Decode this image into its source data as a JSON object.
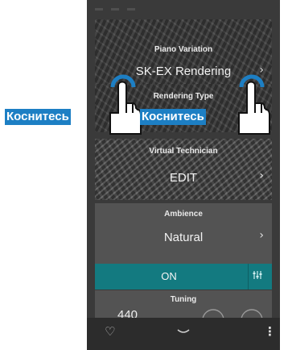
{
  "piano_variation": {
    "label": "Piano Variation",
    "value": "SK-EX Rendering"
  },
  "rendering_type": {
    "label": "Rendering Type"
  },
  "virtual_technician": {
    "label": "Virtual Technician",
    "value": "EDIT"
  },
  "ambience": {
    "label": "Ambience",
    "value": "Natural",
    "toggle": "ON"
  },
  "tuning": {
    "label": "Tuning",
    "value": "440"
  },
  "annotations": {
    "left_touch": "Коснитесь",
    "right_touch": "Коснитесь"
  },
  "colors": {
    "accent_teal": "#137a80",
    "annotation_blue": "#1d7fc4"
  },
  "icons": {
    "chevron": "›",
    "heart": "♡",
    "menu": "⋮",
    "handle": "⌄"
  }
}
